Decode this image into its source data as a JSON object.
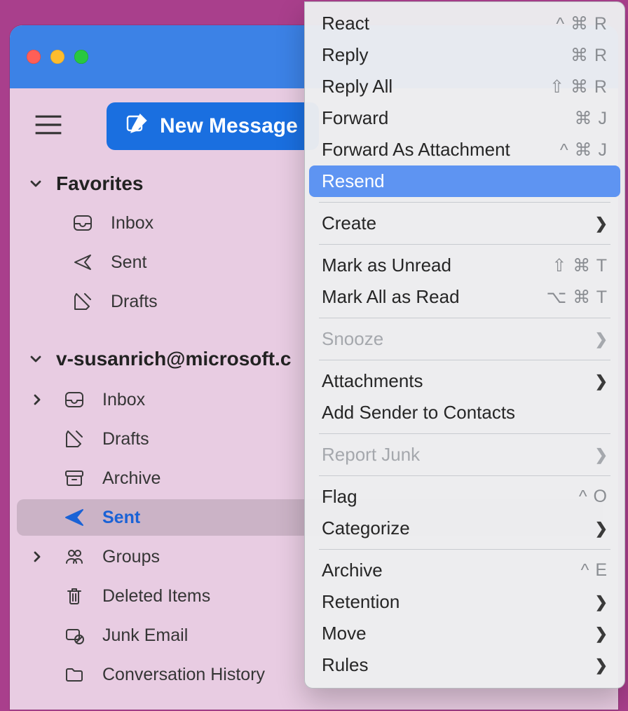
{
  "toolbar": {
    "new_message_label": "New Message"
  },
  "sidebar": {
    "favorites_label": "Favorites",
    "favorites": [
      {
        "id": "inbox",
        "label": "Inbox"
      },
      {
        "id": "sent",
        "label": "Sent"
      },
      {
        "id": "drafts",
        "label": "Drafts"
      }
    ],
    "account_label": "v-susanrich@microsoft.c",
    "account_folders": [
      {
        "id": "inbox",
        "label": "Inbox",
        "expandable": true
      },
      {
        "id": "drafts",
        "label": "Drafts"
      },
      {
        "id": "archive",
        "label": "Archive"
      },
      {
        "id": "sent",
        "label": "Sent",
        "selected": true
      },
      {
        "id": "groups",
        "label": "Groups",
        "expandable": true
      },
      {
        "id": "deleted",
        "label": "Deleted Items"
      },
      {
        "id": "junk",
        "label": "Junk Email"
      },
      {
        "id": "convhist",
        "label": "Conversation History"
      }
    ]
  },
  "context_menu": {
    "items": [
      {
        "label": "React",
        "shortcut": "^ ⌘ R"
      },
      {
        "label": "Reply",
        "shortcut": "⌘ R"
      },
      {
        "label": "Reply All",
        "shortcut": "⇧ ⌘ R"
      },
      {
        "label": "Forward",
        "shortcut": "⌘ J"
      },
      {
        "label": "Forward As Attachment",
        "shortcut": "^ ⌘ J"
      },
      {
        "label": "Resend",
        "highlight": true
      },
      {
        "sep": true
      },
      {
        "label": "Create",
        "submenu": true
      },
      {
        "sep": true
      },
      {
        "label": "Mark as Unread",
        "shortcut": "⇧ ⌘ T"
      },
      {
        "label": "Mark All as Read",
        "shortcut": "⌥ ⌘ T"
      },
      {
        "sep": true
      },
      {
        "label": "Snooze",
        "submenu": true,
        "disabled": true
      },
      {
        "sep": true
      },
      {
        "label": "Attachments",
        "submenu": true
      },
      {
        "label": "Add Sender to Contacts"
      },
      {
        "sep": true
      },
      {
        "label": "Report Junk",
        "submenu": true,
        "disabled": true
      },
      {
        "sep": true
      },
      {
        "label": "Flag",
        "shortcut": "^ O"
      },
      {
        "label": "Categorize",
        "submenu": true
      },
      {
        "sep": true
      },
      {
        "label": "Archive",
        "shortcut": "^ E"
      },
      {
        "label": "Retention",
        "submenu": true
      },
      {
        "label": "Move",
        "submenu": true
      },
      {
        "label": "Rules",
        "submenu": true
      }
    ]
  }
}
